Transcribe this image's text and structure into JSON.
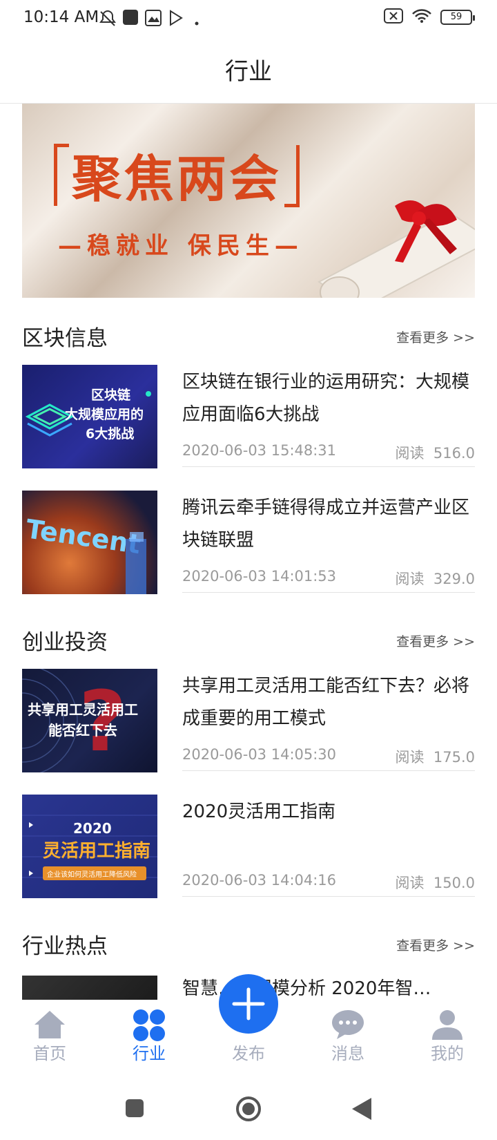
{
  "status_bar": {
    "time": "10:14 AM",
    "battery": "59"
  },
  "header": {
    "title": "行业"
  },
  "banner": {
    "title": "聚焦两会",
    "subtitle": "—稳就业  保民生—"
  },
  "sections": [
    {
      "title": "区块信息",
      "more": "查看更多 >>",
      "items": [
        {
          "title": "区块链在银行业的运用研究：大规模应用面临6大挑战",
          "thumb_text": "区块链 大规模应用的 6大挑战",
          "date": "2020-06-03 15:48:31",
          "read_label": "阅读",
          "read_count": "516.0"
        },
        {
          "title": "腾讯云牵手链得得成立并运营产业区块链联盟",
          "thumb_text": "Tencent",
          "date": "2020-06-03 14:01:53",
          "read_label": "阅读",
          "read_count": "329.0"
        }
      ]
    },
    {
      "title": "创业投资",
      "more": "查看更多 >>",
      "items": [
        {
          "title": "共享用工灵活用工能否红下去？必将成重要的用工模式",
          "thumb_text": "共享用工灵活用工 能否红下去",
          "date": "2020-06-03 14:05:30",
          "read_label": "阅读",
          "read_count": "175.0"
        },
        {
          "title": "2020灵活用工指南",
          "thumb_text": "2020 灵活用工指南",
          "thumb_sub": "企业该如何灵活用工降低风险",
          "date": "2020-06-03 14:04:16",
          "read_label": "阅读",
          "read_count": "150.0"
        }
      ]
    },
    {
      "title": "行业热点",
      "more": "查看更多 >>",
      "items": [
        {
          "title": "智慧…场规模分析 2020年智…"
        }
      ]
    }
  ],
  "tabs": [
    {
      "label": "首页",
      "icon": "home-icon",
      "active": false
    },
    {
      "label": "行业",
      "icon": "grid-icon",
      "active": true
    },
    {
      "label": "发布",
      "icon": "plus-icon",
      "active": false
    },
    {
      "label": "消息",
      "icon": "chat-icon",
      "active": false
    },
    {
      "label": "我的",
      "icon": "user-icon",
      "active": false
    }
  ],
  "colors": {
    "accent": "#1e6ff0",
    "inactive": "#a7adbd",
    "banner_red": "#d8481c"
  }
}
